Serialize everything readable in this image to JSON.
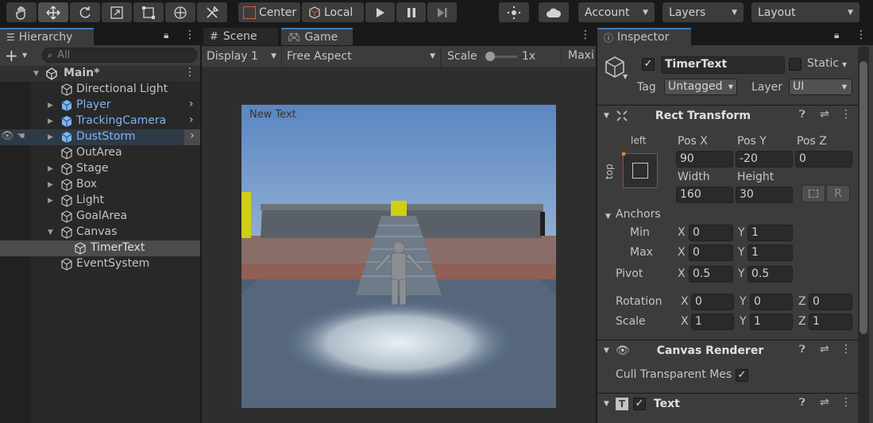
{
  "toolbar": {
    "pivot_label": "Center",
    "space_label": "Local",
    "account_label": "Account",
    "layers_label": "Layers",
    "layout_label": "Layout"
  },
  "hierarchy": {
    "tab_label": "Hierarchy",
    "add_label": "+",
    "search_placeholder": "All",
    "items": [
      {
        "label": "Main*",
        "icon": "unity-scene-icon",
        "prefab": false
      },
      {
        "label": "Directional Light",
        "icon": "gameobject-icon",
        "prefab": false
      },
      {
        "label": "Player",
        "icon": "prefab-icon",
        "prefab": true
      },
      {
        "label": "TrackingCamera",
        "icon": "prefab-icon",
        "prefab": true
      },
      {
        "label": "DustStorm",
        "icon": "prefab-icon",
        "prefab": true
      },
      {
        "label": "OutArea",
        "icon": "gameobject-icon",
        "prefab": false
      },
      {
        "label": "Stage",
        "icon": "gameobject-icon",
        "prefab": false
      },
      {
        "label": "Box",
        "icon": "gameobject-icon",
        "prefab": false
      },
      {
        "label": "Light",
        "icon": "gameobject-icon",
        "prefab": false
      },
      {
        "label": "GoalArea",
        "icon": "gameobject-icon",
        "prefab": false
      },
      {
        "label": "Canvas",
        "icon": "gameobject-icon",
        "prefab": false
      },
      {
        "label": "TimerText",
        "icon": "gameobject-icon",
        "prefab": false
      },
      {
        "label": "EventSystem",
        "icon": "gameobject-icon",
        "prefab": false
      }
    ]
  },
  "game": {
    "scene_tab": "Scene",
    "game_tab": "Game",
    "display": "Display 1",
    "aspect": "Free Aspect",
    "scale_label": "Scale",
    "scale_value": "1x",
    "maximize": "Maxi",
    "overlay_text": "New Text"
  },
  "inspector": {
    "tab_label": "Inspector",
    "object_name": "TimerText",
    "static_label": "Static",
    "tag_label": "Tag",
    "tag_value": "Untagged",
    "layer_label": "Layer",
    "layer_value": "UI",
    "rect_transform": {
      "title": "Rect Transform",
      "anchor_h": "left",
      "anchor_v": "top",
      "posx_label": "Pos X",
      "posy_label": "Pos Y",
      "posz_label": "Pos Z",
      "posx": "90",
      "posy": "-20",
      "posz": "0",
      "width_label": "Width",
      "height_label": "Height",
      "width": "160",
      "height": "30",
      "raw_edit": "R",
      "anchors_label": "Anchors",
      "min_label": "Min",
      "max_label": "Max",
      "min_x": "0",
      "min_y": "1",
      "max_x": "0",
      "max_y": "1",
      "pivot_label": "Pivot",
      "pivot_x": "0.5",
      "pivot_y": "0.5",
      "rotation_label": "Rotation",
      "rot_x": "0",
      "rot_y": "0",
      "rot_z": "0",
      "scale_label": "Scale",
      "scale_x": "1",
      "scale_y": "1",
      "scale_z": "1",
      "x": "X",
      "y": "Y",
      "z": "Z"
    },
    "canvas_renderer": {
      "title": "Canvas Renderer",
      "cull_label": "Cull Transparent Mes"
    },
    "text": {
      "title": "Text",
      "icon_letter": "T"
    }
  },
  "colors": {
    "accent": "#3a79bb",
    "prefab": "#7eb4f1",
    "selected": "#2c5d87"
  }
}
